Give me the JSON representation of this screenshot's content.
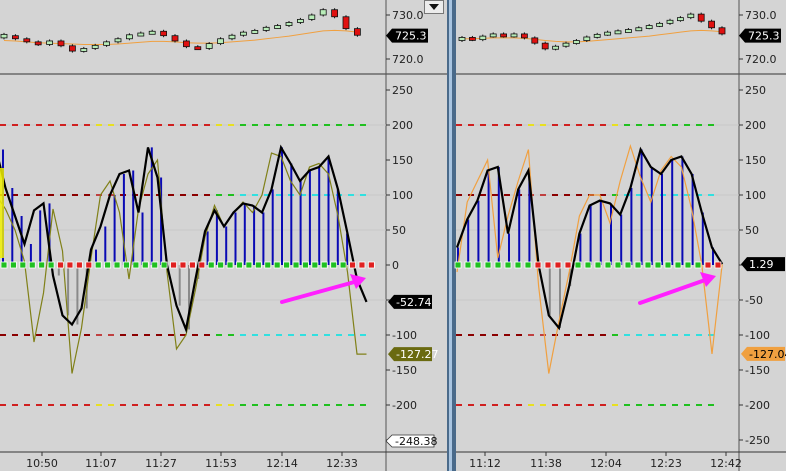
{
  "panels": [
    {
      "id": "left",
      "price": {
        "ticks": [
          "730.0",
          "720.0"
        ],
        "last_tag": "725.3",
        "candles": [
          [
            724.8,
            725.6
          ],
          [
            725.3,
            724.6
          ],
          [
            724.6,
            723.9
          ],
          [
            723.9,
            723.3
          ],
          [
            723.3,
            724.1
          ],
          [
            724.1,
            723.0
          ],
          [
            723.0,
            721.8
          ],
          [
            721.8,
            722.4
          ],
          [
            722.4,
            723.1
          ],
          [
            723.1,
            723.9
          ],
          [
            723.9,
            724.6
          ],
          [
            724.6,
            725.5
          ],
          [
            725.5,
            725.9
          ],
          [
            725.9,
            726.3
          ],
          [
            726.3,
            725.3
          ],
          [
            725.3,
            724.1
          ],
          [
            724.1,
            722.8
          ],
          [
            722.8,
            722.4
          ],
          [
            722.4,
            723.5
          ],
          [
            723.5,
            724.6
          ],
          [
            724.6,
            725.4
          ],
          [
            725.4,
            726.1
          ],
          [
            726.1,
            726.5
          ],
          [
            726.5,
            727.2
          ],
          [
            727.2,
            727.6
          ],
          [
            727.6,
            728.3
          ],
          [
            728.3,
            729.0
          ],
          [
            729.0,
            730.0
          ],
          [
            730.0,
            731.2
          ],
          [
            731.2,
            729.6
          ],
          [
            729.6,
            726.9
          ],
          [
            726.9,
            725.4
          ]
        ],
        "ma": [
          724.2,
          724.1,
          723.9,
          723.7,
          723.6,
          723.5,
          723.4,
          723.3,
          723.3,
          723.3,
          723.4,
          723.6,
          723.8,
          724.0,
          724.0,
          723.9,
          723.7,
          723.6,
          723.6,
          723.7,
          723.9,
          724.1,
          724.3,
          724.6,
          724.9,
          725.2,
          725.6,
          726.0,
          726.4,
          726.5,
          726.4,
          726.1
        ]
      },
      "osc": {
        "ticks": [
          "250",
          "200",
          "150",
          "100",
          "50",
          "0",
          "-50",
          "-100",
          "-150",
          "-200",
          "-250"
        ],
        "tag_main": "-52.74",
        "tag_signal": "-127.27",
        "tag_bottom": "-248.38",
        "histogram": [
          165,
          110,
          70,
          30,
          78,
          88,
          -15,
          -72,
          -85,
          -62,
          22,
          55,
          100,
          130,
          135,
          75,
          168,
          125,
          0,
          -58,
          -92,
          -20,
          48,
          78,
          55,
          75,
          88,
          85,
          75,
          108,
          168,
          145,
          120,
          135,
          140,
          155,
          108,
          45
        ],
        "main": [
          165,
          110,
          70,
          30,
          78,
          88,
          -15,
          -72,
          -85,
          -62,
          22,
          55,
          100,
          130,
          135,
          75,
          168,
          125,
          0,
          -58,
          -92,
          -20,
          48,
          78,
          55,
          75,
          88,
          85,
          75,
          108,
          168,
          145,
          120,
          135,
          140,
          155,
          108,
          45,
          -20,
          -52.74
        ],
        "signal": [
          100,
          80,
          50,
          5,
          -110,
          -40,
          80,
          20,
          -155,
          -90,
          10,
          100,
          120,
          75,
          -20,
          80,
          130,
          150,
          -10,
          -120,
          -100,
          -35,
          40,
          85,
          55,
          75,
          90,
          75,
          100,
          160,
          155,
          120,
          100,
          140,
          145,
          130,
          70,
          -10,
          -127.27,
          -127.27
        ],
        "dots": [
          "g",
          "g",
          "g",
          "g",
          "g",
          "g",
          "r",
          "r",
          "r",
          "r",
          "g",
          "g",
          "g",
          "g",
          "g",
          "g",
          "g",
          "g",
          "r",
          "r",
          "r",
          "r",
          "g",
          "g",
          "g",
          "g",
          "g",
          "g",
          "g",
          "g",
          "g",
          "g",
          "g",
          "g",
          "g",
          "g",
          "g",
          "r",
          "r",
          "r"
        ]
      },
      "time_labels": [
        "10:50",
        "11:07",
        "11:27",
        "11:53",
        "12:14",
        "12:33"
      ]
    },
    {
      "id": "right",
      "price": {
        "ticks": [
          "730.0",
          "720.0"
        ],
        "last_tag": "725.3",
        "candles": [
          [
            724.2,
            724.9
          ],
          [
            724.9,
            724.4
          ],
          [
            724.4,
            725.2
          ],
          [
            725.2,
            725.7
          ],
          [
            725.7,
            725.2
          ],
          [
            725.2,
            725.7
          ],
          [
            725.7,
            724.8
          ],
          [
            724.8,
            723.6
          ],
          [
            723.6,
            722.3
          ],
          [
            722.3,
            722.9
          ],
          [
            722.9,
            723.6
          ],
          [
            723.6,
            724.2
          ],
          [
            724.2,
            725.0
          ],
          [
            725.0,
            725.6
          ],
          [
            725.6,
            726.1
          ],
          [
            726.1,
            726.4
          ],
          [
            726.4,
            726.7
          ],
          [
            726.7,
            727.1
          ],
          [
            727.1,
            727.6
          ],
          [
            727.6,
            728.1
          ],
          [
            728.1,
            728.8
          ],
          [
            728.8,
            729.4
          ],
          [
            729.4,
            730.2
          ],
          [
            730.2,
            728.6
          ],
          [
            728.6,
            727.1
          ],
          [
            727.1,
            725.7
          ]
        ],
        "ma": [
          724.6,
          724.6,
          724.7,
          724.8,
          724.8,
          724.8,
          724.7,
          724.5,
          724.2,
          724.0,
          723.9,
          723.9,
          724.0,
          724.2,
          724.4,
          724.6,
          724.8,
          725.0,
          725.2,
          725.5,
          725.8,
          726.1,
          726.4,
          726.5,
          726.4,
          726.2
        ]
      },
      "osc": {
        "ticks": [
          "250",
          "200",
          "150",
          "100",
          "50",
          "0",
          "-50",
          "-100",
          "-150",
          "-200",
          "-250"
        ],
        "tag_main": "1.29",
        "tag_signal": "-127.04",
        "histogram": [
          25,
          65,
          92,
          135,
          140,
          45,
          108,
          135,
          0,
          -72,
          -90,
          -30,
          45,
          85,
          92,
          88,
          72,
          110,
          165,
          140,
          130,
          150,
          155,
          130,
          75,
          25
        ],
        "main": [
          25,
          65,
          92,
          135,
          140,
          45,
          108,
          135,
          0,
          -72,
          -90,
          -30,
          45,
          85,
          92,
          88,
          72,
          110,
          165,
          140,
          130,
          150,
          155,
          130,
          75,
          25,
          1.29
        ],
        "signal": [
          -10,
          90,
          120,
          150,
          10,
          70,
          120,
          165,
          -30,
          -155,
          -80,
          -10,
          70,
          100,
          100,
          60,
          120,
          170,
          125,
          90,
          135,
          155,
          140,
          80,
          0,
          -127.04,
          1.29
        ],
        "dots": [
          "g",
          "g",
          "g",
          "g",
          "g",
          "g",
          "g",
          "g",
          "r",
          "r",
          "r",
          "r",
          "g",
          "g",
          "g",
          "g",
          "g",
          "g",
          "g",
          "g",
          "g",
          "g",
          "g",
          "g",
          "g",
          "r",
          "r"
        ]
      },
      "time_labels": [
        "11:12",
        "11:38",
        "12:04",
        "12:23",
        "12:42"
      ]
    }
  ],
  "colors": {
    "background": "#d4d4d4",
    "histogram": "#0a0ab4",
    "main_line": "#000000",
    "signal_left": "#808018",
    "signal_right": "#f0a040",
    "ma_line": "#f0a040",
    "candle_up": "#b8ecb8",
    "candle_down": "#e01010",
    "arrow": "#ff20ff",
    "level_200": "#d02020",
    "level_100": "#8b0000",
    "level_100_right": "#30e0e0",
    "dot_green": "#20c020",
    "dot_red": "#e02020"
  }
}
